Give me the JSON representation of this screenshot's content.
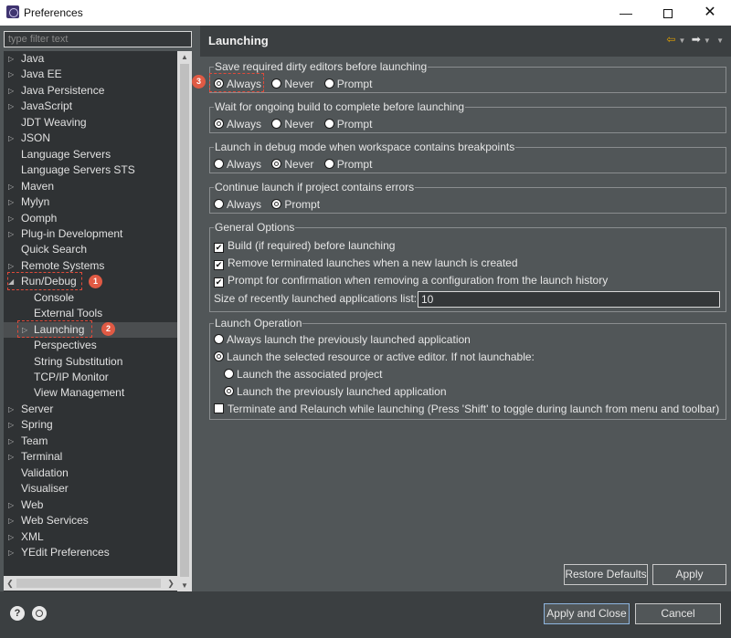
{
  "window": {
    "title": "Preferences",
    "minimize": "—",
    "close": "✕"
  },
  "filter": {
    "placeholder": "type filter text"
  },
  "tree": [
    {
      "label": "Java",
      "twisty": "▷",
      "indent": 0
    },
    {
      "label": "Java EE",
      "twisty": "▷",
      "indent": 0
    },
    {
      "label": "Java Persistence",
      "twisty": "▷",
      "indent": 0
    },
    {
      "label": "JavaScript",
      "twisty": "▷",
      "indent": 0
    },
    {
      "label": "JDT Weaving",
      "twisty": "",
      "indent": 0
    },
    {
      "label": "JSON",
      "twisty": "▷",
      "indent": 0
    },
    {
      "label": "Language Servers",
      "twisty": "",
      "indent": 0
    },
    {
      "label": "Language Servers STS",
      "twisty": "",
      "indent": 0
    },
    {
      "label": "Maven",
      "twisty": "▷",
      "indent": 0
    },
    {
      "label": "Mylyn",
      "twisty": "▷",
      "indent": 0
    },
    {
      "label": "Oomph",
      "twisty": "▷",
      "indent": 0
    },
    {
      "label": "Plug-in Development",
      "twisty": "▷",
      "indent": 0
    },
    {
      "label": "Quick Search",
      "twisty": "",
      "indent": 0
    },
    {
      "label": "Remote Systems",
      "twisty": "▷",
      "indent": 0
    },
    {
      "label": "Run/Debug",
      "twisty": "◢",
      "indent": 0
    },
    {
      "label": "Console",
      "twisty": "",
      "indent": 1
    },
    {
      "label": "External Tools",
      "twisty": "",
      "indent": 1
    },
    {
      "label": "Launching",
      "twisty": "▷",
      "indent": 1,
      "selected": true
    },
    {
      "label": "Perspectives",
      "twisty": "",
      "indent": 1
    },
    {
      "label": "String Substitution",
      "twisty": "",
      "indent": 1
    },
    {
      "label": "TCP/IP Monitor",
      "twisty": "",
      "indent": 1
    },
    {
      "label": "View Management",
      "twisty": "",
      "indent": 1
    },
    {
      "label": "Server",
      "twisty": "▷",
      "indent": 0
    },
    {
      "label": "Spring",
      "twisty": "▷",
      "indent": 0
    },
    {
      "label": "Team",
      "twisty": "▷",
      "indent": 0
    },
    {
      "label": "Terminal",
      "twisty": "▷",
      "indent": 0
    },
    {
      "label": "Validation",
      "twisty": "",
      "indent": 0
    },
    {
      "label": "Visualiser",
      "twisty": "",
      "indent": 0
    },
    {
      "label": "Web",
      "twisty": "▷",
      "indent": 0
    },
    {
      "label": "Web Services",
      "twisty": "▷",
      "indent": 0
    },
    {
      "label": "XML",
      "twisty": "▷",
      "indent": 0
    },
    {
      "label": "YEdit Preferences",
      "twisty": "▷",
      "indent": 0
    }
  ],
  "page": {
    "title": "Launching",
    "nav": {
      "back": "⇦",
      "forward": "➡",
      "menu": "▼"
    }
  },
  "groups": {
    "save_dirty": {
      "label": "Save required dirty editors before launching",
      "options": [
        "Always",
        "Never",
        "Prompt"
      ],
      "selected": "Always"
    },
    "wait_build": {
      "label": "Wait for ongoing build to complete before launching",
      "options": [
        "Always",
        "Never",
        "Prompt"
      ],
      "selected": "Always"
    },
    "debug_mode": {
      "label": "Launch in debug mode when workspace contains breakpoints",
      "options": [
        "Always",
        "Never",
        "Prompt"
      ],
      "selected": "Never"
    },
    "continue_errors": {
      "label": "Continue launch if project contains errors",
      "options": [
        "Always",
        "Prompt"
      ],
      "selected": "Prompt"
    },
    "general": {
      "label": "General Options",
      "build_before": "Build (if required) before launching",
      "remove_terminated": "Remove terminated launches when a new launch is created",
      "prompt_confirm": "Prompt for confirmation when removing a configuration from the launch history",
      "size_label": "Size of recently launched applications list:",
      "size_value": "10"
    },
    "operation": {
      "label": "Launch Operation",
      "always_previous": "Always launch the previously launched application",
      "launch_selected": "Launch the selected resource or active editor. If not launchable:",
      "launch_associated": "Launch the associated project",
      "launch_previous": "Launch the previously launched application",
      "terminate_relaunch": "Terminate and Relaunch while launching (Press 'Shift' to toggle during launch from menu and toolbar)"
    }
  },
  "buttons": {
    "restore_defaults": "Restore Defaults",
    "apply": "Apply",
    "apply_close": "Apply and Close",
    "cancel": "Cancel"
  },
  "bottom": {
    "help": "?"
  },
  "annotations": {
    "one": "1",
    "two": "2",
    "three": "3"
  },
  "colors": {
    "accent": "#e05a44",
    "background": "#515658",
    "tree_bg": "#2f3234"
  }
}
